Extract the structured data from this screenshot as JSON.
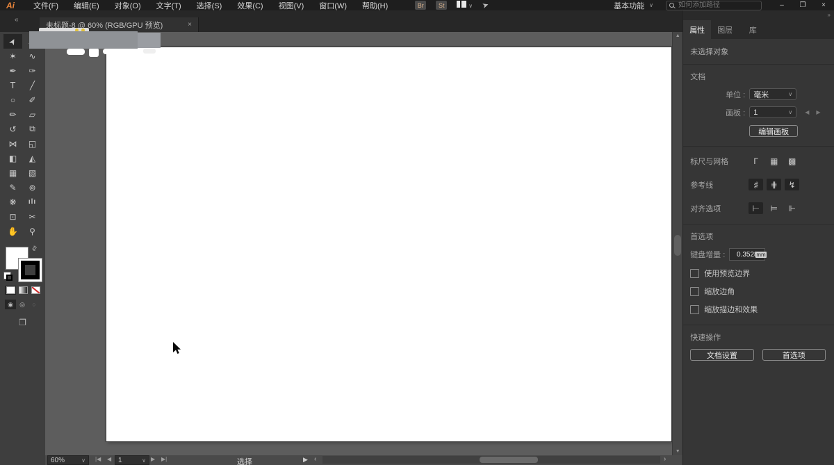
{
  "menubar": {
    "logo": "Ai",
    "menus": [
      {
        "name": "menu-file",
        "label": "文件(F)"
      },
      {
        "name": "menu-edit",
        "label": "编辑(E)"
      },
      {
        "name": "menu-object",
        "label": "对象(O)"
      },
      {
        "name": "menu-type",
        "label": "文字(T)"
      },
      {
        "name": "menu-select",
        "label": "选择(S)"
      },
      {
        "name": "menu-effect",
        "label": "效果(C)"
      },
      {
        "name": "menu-view",
        "label": "视图(V)"
      },
      {
        "name": "menu-window",
        "label": "窗口(W)"
      },
      {
        "name": "menu-help",
        "label": "帮助(H)"
      }
    ],
    "bridge_label": "Br",
    "stock_label": "St",
    "workspace_label": "基本功能",
    "search_placeholder": "如何添加路径",
    "icons": {
      "chevron_down": "∨",
      "minimize": "–",
      "restore": "❐",
      "close": "×",
      "share": "➤"
    }
  },
  "tabbar": {
    "collapse_icon": "«",
    "tab_title": "未标题-8 @ 60% (RGB/GPU 预览)",
    "close_icon": "×"
  },
  "toolbar": {
    "tools": [
      {
        "name": "selection-tool",
        "glyph": "➤",
        "selected": true
      },
      {
        "name": "direct-selection-tool",
        "glyph": "▷"
      },
      {
        "name": "magic-wand-tool",
        "glyph": "✶"
      },
      {
        "name": "lasso-tool",
        "glyph": "∿"
      },
      {
        "name": "pen-tool",
        "glyph": "✒"
      },
      {
        "name": "curvature-tool",
        "glyph": "✑"
      },
      {
        "name": "type-tool",
        "glyph": "T"
      },
      {
        "name": "line-segment-tool",
        "glyph": "╱"
      },
      {
        "name": "ellipse-tool",
        "glyph": "○"
      },
      {
        "name": "paintbrush-tool",
        "glyph": "✐"
      },
      {
        "name": "shaper-tool",
        "glyph": "✏"
      },
      {
        "name": "eraser-tool",
        "glyph": "▱"
      },
      {
        "name": "rotate-tool",
        "glyph": "↺"
      },
      {
        "name": "scale-tool",
        "glyph": "⧉"
      },
      {
        "name": "width-tool",
        "glyph": "⋈"
      },
      {
        "name": "free-transform-tool",
        "glyph": "◱"
      },
      {
        "name": "shape-builder-tool",
        "glyph": "◧"
      },
      {
        "name": "perspective-grid-tool",
        "glyph": "◭"
      },
      {
        "name": "mesh-tool",
        "glyph": "▦"
      },
      {
        "name": "gradient-tool",
        "glyph": "▧"
      },
      {
        "name": "eyedropper-tool",
        "glyph": "✎"
      },
      {
        "name": "blend-tool",
        "glyph": "⊚"
      },
      {
        "name": "symbol-sprayer-tool",
        "glyph": "❋"
      },
      {
        "name": "column-graph-tool",
        "glyph": "ılı"
      },
      {
        "name": "artboard-tool",
        "glyph": "⊡"
      },
      {
        "name": "slice-tool",
        "glyph": "✂"
      },
      {
        "name": "hand-tool",
        "glyph": "✋"
      },
      {
        "name": "zoom-tool",
        "glyph": "⚲"
      }
    ],
    "swap_icon": "⇄",
    "draw_modes": [
      {
        "name": "draw-normal-mode",
        "glyph": "◉",
        "pressed": true
      },
      {
        "name": "draw-behind-mode",
        "glyph": "◎"
      },
      {
        "name": "draw-inside-mode",
        "glyph": "○",
        "disabled": true
      }
    ],
    "screen_mode_icon": "❐"
  },
  "scrollbars": {
    "up": "▲",
    "down": "▼",
    "left": "‹",
    "right": "›"
  },
  "statusbar": {
    "zoom_value": "60%",
    "chevron": "∨",
    "nav_first": "|◀",
    "nav_prev": "◀",
    "artboard_value": "1",
    "nav_next": "▶",
    "nav_last": "▶|",
    "status_text": "选择",
    "play_icon": "▶"
  },
  "panel": {
    "expand_icon": "»",
    "tabs": [
      {
        "name": "tab-properties",
        "label": "属性",
        "active": true
      },
      {
        "name": "tab-layers",
        "label": "图层"
      },
      {
        "name": "tab-libraries",
        "label": "库"
      }
    ],
    "no_selection": "未选择对象",
    "document": {
      "header": "文档",
      "unit_label": "单位 :",
      "unit_value": "毫米",
      "artboard_label": "画板 :",
      "artboard_value": "1",
      "pager_prev": "◀",
      "pager_next": "▶",
      "edit_artboard_label": "编辑画板"
    },
    "rulers": {
      "label": "标尺与网格",
      "icons": [
        {
          "name": "ruler-corner-icon",
          "glyph": "Γ"
        },
        {
          "name": "grid-icon",
          "glyph": "▦"
        },
        {
          "name": "pixel-grid-icon",
          "glyph": "▩"
        }
      ]
    },
    "guides": {
      "label": "参考线",
      "icons": [
        {
          "name": "show-guides-icon",
          "glyph": "♯",
          "pressed": true
        },
        {
          "name": "lock-guides-icon",
          "glyph": "⋕",
          "pressed": true
        },
        {
          "name": "smart-guides-icon",
          "glyph": "↯",
          "pressed": true
        }
      ]
    },
    "snap": {
      "label": "对齐选项",
      "icons": [
        {
          "name": "snap-point-icon",
          "glyph": "⊢",
          "pressed": true
        },
        {
          "name": "snap-grid-icon",
          "glyph": "⊨"
        },
        {
          "name": "snap-glyph-icon",
          "glyph": "⊩"
        }
      ]
    },
    "preferences": {
      "header": "首选项",
      "keyboard_label": "键盘增量 :",
      "keyboard_value": "0.3528",
      "keyboard_unit": "mm",
      "checkboxes": [
        {
          "label": "使用预览边界"
        },
        {
          "label": "缩放边角"
        },
        {
          "label": "缩放描边和效果"
        }
      ]
    },
    "quick": {
      "header": "快速操作",
      "buttons": [
        {
          "name": "document-setup-button",
          "label": "文档设置"
        },
        {
          "name": "preferences-button",
          "label": "首选项"
        }
      ]
    }
  }
}
